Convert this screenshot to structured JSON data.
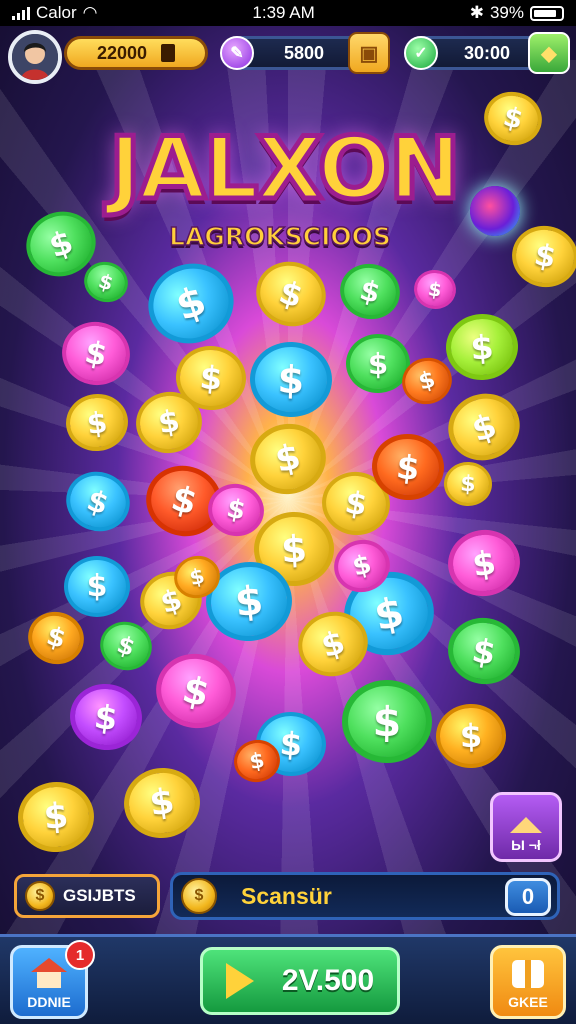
{
  "status_bar": {
    "carrier": "Calor",
    "time": "1:39 AM",
    "battery": "39%"
  },
  "top_bar": {
    "coins": "22000",
    "coins_icon": "coin-stack-icon",
    "gems": "5800",
    "gems_icon": "potion-icon",
    "energy": "30:00",
    "energy_icon": "check-icon"
  },
  "title": {
    "main": "JALXON",
    "sub": "LAGROKSCIOOS"
  },
  "coins": [
    {
      "c": "#3ac2ff"
    },
    {
      "c": "#ffd23a"
    },
    {
      "c": "#4fe05e"
    },
    {
      "c": "#ff5cd8"
    },
    {
      "c": "#ff5cd8"
    },
    {
      "c": "#ffd23a"
    },
    {
      "c": "#3ac2ff"
    },
    {
      "c": "#4fe05e"
    },
    {
      "c": "#a6f03a"
    },
    {
      "c": "#ffd23a"
    },
    {
      "c": "#ffd23a"
    },
    {
      "c": "#ffd23a"
    },
    {
      "c": "#ff7a1f"
    },
    {
      "c": "#ffd23a"
    },
    {
      "c": "#3ac2ff"
    },
    {
      "c": "#ff5a2a"
    },
    {
      "c": "#ff5cd8"
    },
    {
      "c": "#ffd23a"
    },
    {
      "c": "#ff6a1f"
    },
    {
      "c": "#ffd23a"
    },
    {
      "c": "#3ac2ff"
    },
    {
      "c": "#ffd23a"
    },
    {
      "c": "#3ac2ff"
    },
    {
      "c": "#ff5cd8"
    },
    {
      "c": "#3ac2ff"
    },
    {
      "c": "#ff5cd8"
    },
    {
      "c": "#ffd23a"
    },
    {
      "c": "#4fe05e"
    },
    {
      "c": "#ffa820"
    },
    {
      "c": "#ff5cd8"
    },
    {
      "c": "#4fe05e"
    },
    {
      "c": "#c34dff"
    },
    {
      "c": "#3ac2ff"
    },
    {
      "c": "#4fe05e"
    },
    {
      "c": "#ffb020"
    },
    {
      "c": "#ffd23a"
    },
    {
      "c": "#ffd23a"
    },
    {
      "c": "#ff6a1f"
    },
    {
      "c": "#ffa820"
    },
    {
      "c": "#ffd23a"
    },
    {
      "c": "#4fe05e"
    },
    {
      "c": "#4fe05e"
    },
    {
      "c": "#ffd23a"
    },
    {
      "c": "#ffd23a"
    }
  ],
  "coin_symbol": "$",
  "side_button": {
    "label": "Ы ¬ł",
    "icon": "house-roof-icon"
  },
  "info_bar": {
    "left_label": "GSIJBTS",
    "main_label": "Scansür",
    "button_label": "0"
  },
  "bottom_nav": {
    "home_label": "DDNIE",
    "home_badge": "1",
    "home_icon": "house-icon",
    "play_value": "2V.500",
    "play_icon": "play-icon",
    "gift_label": "GKEE",
    "gift_icon": "gift-icon"
  },
  "colors": {
    "title_fill": "#ffd23a",
    "title_stroke": "#9c1d8f",
    "play_green": "#2cc25a",
    "accent_orange": "#f5a53a"
  }
}
